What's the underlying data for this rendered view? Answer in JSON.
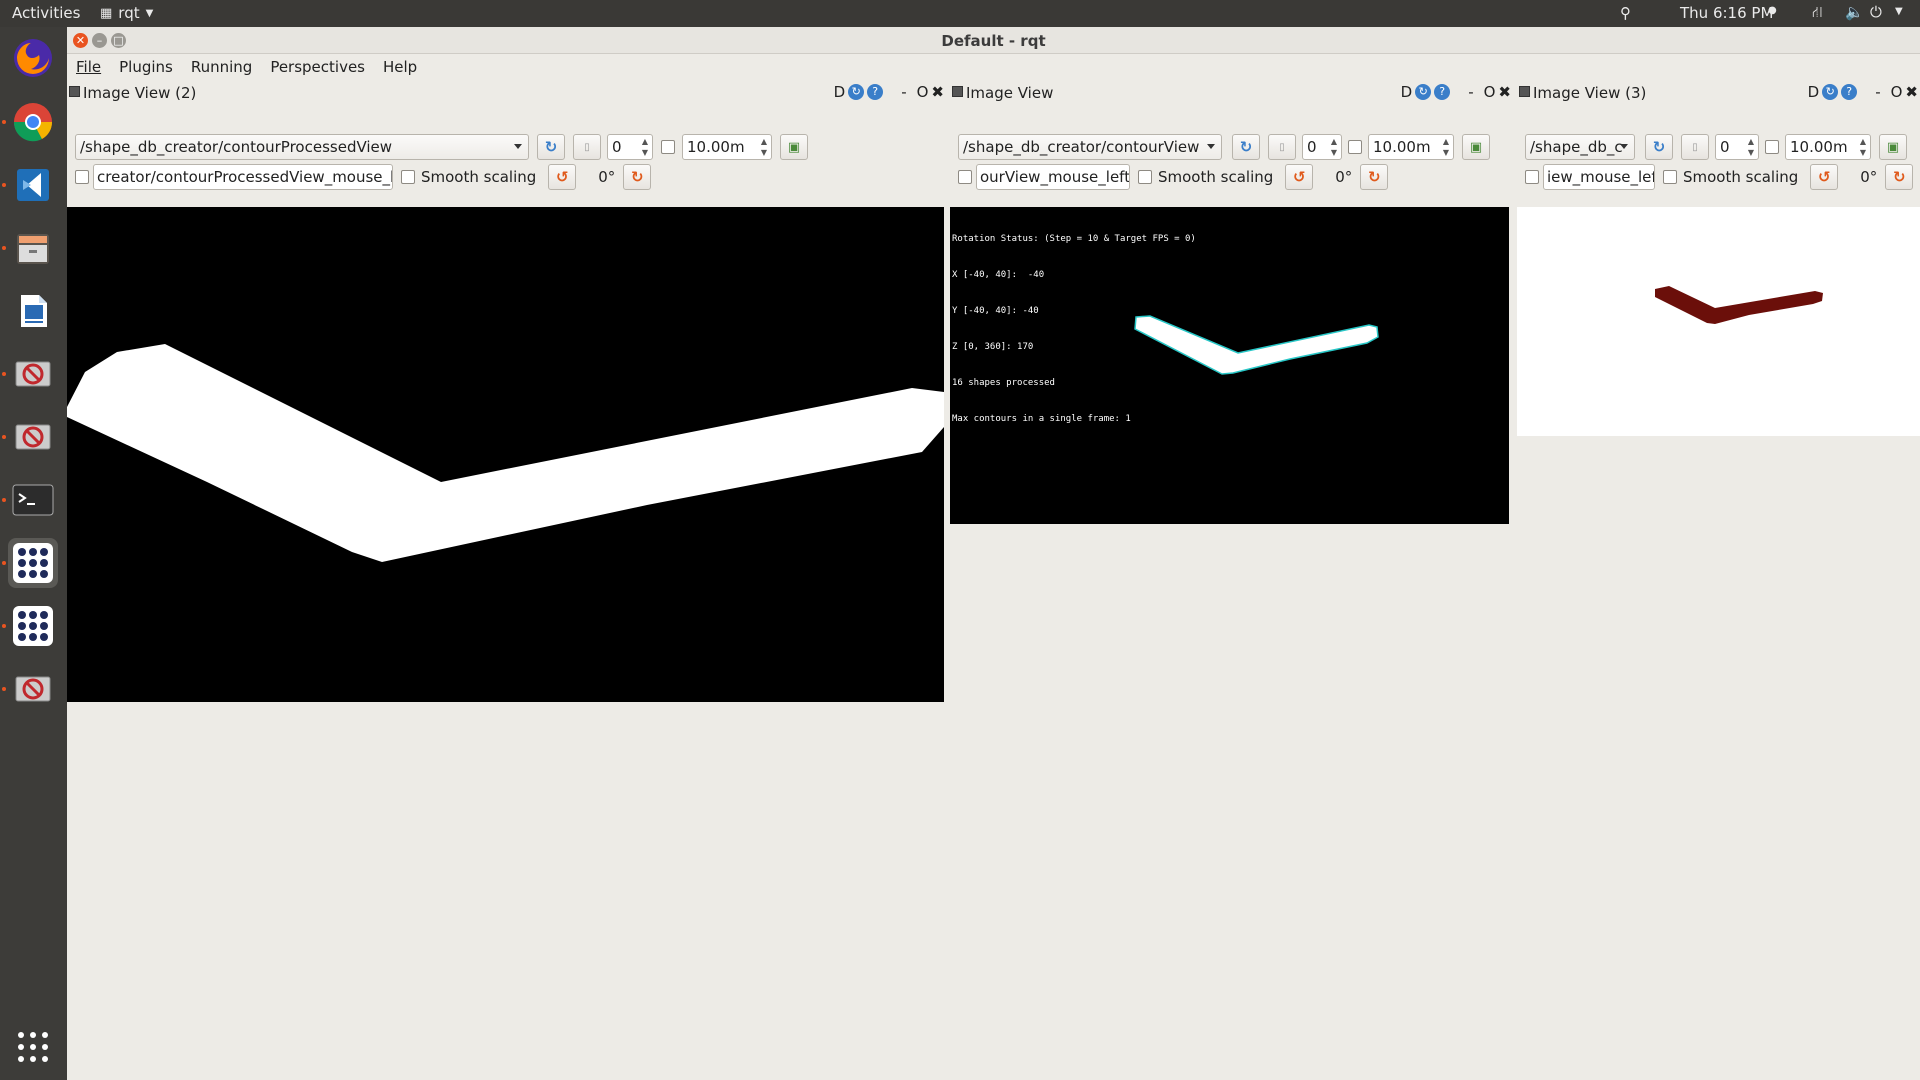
{
  "topbar": {
    "activities": "Activities",
    "app_name": "rqt",
    "clock": "Thu  6:16 PM"
  },
  "window": {
    "title": "Default - rqt"
  },
  "menubar": {
    "items": [
      {
        "label": "File"
      },
      {
        "label": "Plugins"
      },
      {
        "label": "Running"
      },
      {
        "label": "Perspectives"
      },
      {
        "label": "Help"
      }
    ]
  },
  "panels": [
    {
      "title": "Image View (2)",
      "topic": "/shape_db_creator/contourProcessedView",
      "spin_value": "0",
      "timeout_value": "10.00m",
      "mouse_topic": "creator/contourProcessedView_mouse_left",
      "smooth_label": "Smooth scaling",
      "rotation": "0°",
      "dock_letter": "D",
      "minimize": "-",
      "restore": "O"
    },
    {
      "title": "Image View",
      "topic": "/shape_db_creator/contourView",
      "spin_value": "0",
      "timeout_value": "10.00m",
      "mouse_topic": "ourView_mouse_left",
      "smooth_label": "Smooth scaling",
      "rotation": "0°",
      "dock_letter": "D",
      "minimize": "-",
      "restore": "O",
      "overlay_lines": [
        "Rotation Status: (Step = 10 & Target FPS = 0)",
        "X [-40, 40]:  -40",
        "Y [-40, 40]: -40",
        "Z [0, 360]: 170",
        "16 shapes processed",
        "Max contours in a single frame: 1"
      ]
    },
    {
      "title": "Image View (3)",
      "topic": "/shape_db_c",
      "spin_value": "0",
      "timeout_value": "10.00m",
      "mouse_topic": "iew_mouse_left",
      "smooth_label": "Smooth scaling",
      "rotation": "0°",
      "dock_letter": "D",
      "minimize": "-",
      "restore": "O"
    }
  ],
  "colors": {
    "ubuntu_orange": "#e95420",
    "shape_dark_red": "#6b0f0a",
    "contour_cyan": "#27c7c7"
  },
  "dock": {
    "icons": [
      "firefox-icon",
      "chrome-icon",
      "vscode-icon",
      "files-icon",
      "writer-icon",
      "blocked-app-icon",
      "blocked-app-icon",
      "terminal-icon",
      "app-grid-icon",
      "app-grid-icon",
      "blocked-app-icon",
      "show-apps-icon"
    ]
  }
}
